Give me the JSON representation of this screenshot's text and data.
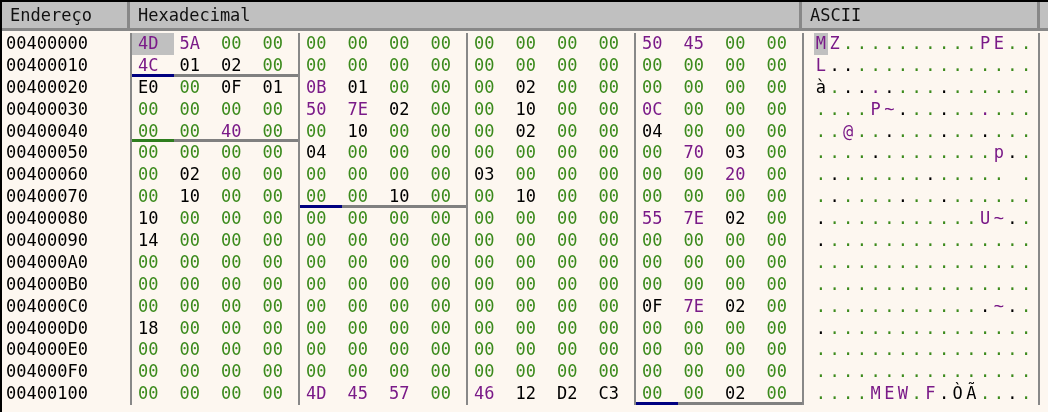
{
  "columns": [
    "Endereço",
    "Hexadecimal",
    "ASCII"
  ],
  "rows": [
    {
      "address": "00400000",
      "ascii": "MZ..........PE..",
      "bytes": [
        {
          "hex": "4D",
          "kind": "text",
          "selected": true
        },
        {
          "hex": "5A",
          "kind": "text",
          "selected": false
        },
        {
          "hex": "00",
          "kind": "zero",
          "selected": false
        },
        {
          "hex": "00",
          "kind": "zero",
          "selected": false
        },
        {
          "hex": "00",
          "kind": "zero",
          "selected": false
        },
        {
          "hex": "00",
          "kind": "zero",
          "selected": false
        },
        {
          "hex": "00",
          "kind": "zero",
          "selected": false
        },
        {
          "hex": "00",
          "kind": "zero",
          "selected": false
        },
        {
          "hex": "00",
          "kind": "zero",
          "selected": false
        },
        {
          "hex": "00",
          "kind": "zero",
          "selected": false
        },
        {
          "hex": "00",
          "kind": "zero",
          "selected": false
        },
        {
          "hex": "00",
          "kind": "zero",
          "selected": false
        },
        {
          "hex": "50",
          "kind": "text",
          "selected": false
        },
        {
          "hex": "45",
          "kind": "text",
          "selected": false
        },
        {
          "hex": "00",
          "kind": "zero",
          "selected": false
        },
        {
          "hex": "00",
          "kind": "zero",
          "selected": false
        }
      ]
    },
    {
      "address": "00400010",
      "ascii": "L...............",
      "bytes": [
        {
          "hex": "4C",
          "kind": "text",
          "selected": false,
          "color": "#000080"
        },
        {
          "hex": "01",
          "kind": "other",
          "selected": false,
          "color": "#808080"
        },
        {
          "hex": "02",
          "kind": "other",
          "selected": false,
          "color": "#808080"
        },
        {
          "hex": "00",
          "kind": "zero",
          "selected": false,
          "color": "#808080"
        },
        {
          "hex": "00",
          "kind": "zero",
          "selected": false
        },
        {
          "hex": "00",
          "kind": "zero",
          "selected": false
        },
        {
          "hex": "00",
          "kind": "zero",
          "selected": false
        },
        {
          "hex": "00",
          "kind": "zero",
          "selected": false
        },
        {
          "hex": "00",
          "kind": "zero",
          "selected": false
        },
        {
          "hex": "00",
          "kind": "zero",
          "selected": false
        },
        {
          "hex": "00",
          "kind": "zero",
          "selected": false
        },
        {
          "hex": "00",
          "kind": "zero",
          "selected": false
        },
        {
          "hex": "00",
          "kind": "zero",
          "selected": false
        },
        {
          "hex": "00",
          "kind": "zero",
          "selected": false
        },
        {
          "hex": "00",
          "kind": "zero",
          "selected": false
        },
        {
          "hex": "00",
          "kind": "zero",
          "selected": false
        }
      ]
    },
    {
      "address": "00400020",
      "ascii": "à...............",
      "bytes": [
        {
          "hex": "E0",
          "kind": "other",
          "selected": false
        },
        {
          "hex": "00",
          "kind": "zero",
          "selected": false
        },
        {
          "hex": "0F",
          "kind": "other",
          "selected": false
        },
        {
          "hex": "01",
          "kind": "other",
          "selected": false
        },
        {
          "hex": "0B",
          "kind": "text",
          "selected": false
        },
        {
          "hex": "01",
          "kind": "other",
          "selected": false
        },
        {
          "hex": "00",
          "kind": "zero",
          "selected": false
        },
        {
          "hex": "00",
          "kind": "zero",
          "selected": false
        },
        {
          "hex": "00",
          "kind": "zero",
          "selected": false
        },
        {
          "hex": "02",
          "kind": "other",
          "selected": false
        },
        {
          "hex": "00",
          "kind": "zero",
          "selected": false
        },
        {
          "hex": "00",
          "kind": "zero",
          "selected": false
        },
        {
          "hex": "00",
          "kind": "zero",
          "selected": false
        },
        {
          "hex": "00",
          "kind": "zero",
          "selected": false
        },
        {
          "hex": "00",
          "kind": "zero",
          "selected": false
        },
        {
          "hex": "00",
          "kind": "zero",
          "selected": false
        }
      ]
    },
    {
      "address": "00400030",
      "ascii": "....P~..........",
      "bytes": [
        {
          "hex": "00",
          "kind": "zero",
          "selected": false
        },
        {
          "hex": "00",
          "kind": "zero",
          "selected": false
        },
        {
          "hex": "00",
          "kind": "zero",
          "selected": false
        },
        {
          "hex": "00",
          "kind": "zero",
          "selected": false
        },
        {
          "hex": "50",
          "kind": "text",
          "selected": false
        },
        {
          "hex": "7E",
          "kind": "text",
          "selected": false
        },
        {
          "hex": "02",
          "kind": "other",
          "selected": false
        },
        {
          "hex": "00",
          "kind": "zero",
          "selected": false
        },
        {
          "hex": "00",
          "kind": "zero",
          "selected": false
        },
        {
          "hex": "10",
          "kind": "other",
          "selected": false
        },
        {
          "hex": "00",
          "kind": "zero",
          "selected": false
        },
        {
          "hex": "00",
          "kind": "zero",
          "selected": false
        },
        {
          "hex": "0C",
          "kind": "text",
          "selected": false
        },
        {
          "hex": "00",
          "kind": "zero",
          "selected": false
        },
        {
          "hex": "00",
          "kind": "zero",
          "selected": false
        },
        {
          "hex": "00",
          "kind": "zero",
          "selected": false
        }
      ]
    },
    {
      "address": "00400040",
      "ascii": "..@.............",
      "bytes": [
        {
          "hex": "00",
          "kind": "zero",
          "selected": false,
          "color": "#2e7d1e"
        },
        {
          "hex": "00",
          "kind": "zero",
          "selected": false,
          "color": "#808080"
        },
        {
          "hex": "40",
          "kind": "text",
          "selected": false,
          "color": "#808080"
        },
        {
          "hex": "00",
          "kind": "zero",
          "selected": false,
          "color": "#808080"
        },
        {
          "hex": "00",
          "kind": "zero",
          "selected": false
        },
        {
          "hex": "10",
          "kind": "other",
          "selected": false
        },
        {
          "hex": "00",
          "kind": "zero",
          "selected": false
        },
        {
          "hex": "00",
          "kind": "zero",
          "selected": false
        },
        {
          "hex": "00",
          "kind": "zero",
          "selected": false
        },
        {
          "hex": "02",
          "kind": "other",
          "selected": false
        },
        {
          "hex": "00",
          "kind": "zero",
          "selected": false
        },
        {
          "hex": "00",
          "kind": "zero",
          "selected": false
        },
        {
          "hex": "04",
          "kind": "other",
          "selected": false
        },
        {
          "hex": "00",
          "kind": "zero",
          "selected": false
        },
        {
          "hex": "00",
          "kind": "zero",
          "selected": false
        },
        {
          "hex": "00",
          "kind": "zero",
          "selected": false
        }
      ]
    },
    {
      "address": "00400050",
      "ascii": ".............p..",
      "bytes": [
        {
          "hex": "00",
          "kind": "zero",
          "selected": false
        },
        {
          "hex": "00",
          "kind": "zero",
          "selected": false
        },
        {
          "hex": "00",
          "kind": "zero",
          "selected": false
        },
        {
          "hex": "00",
          "kind": "zero",
          "selected": false
        },
        {
          "hex": "04",
          "kind": "other",
          "selected": false
        },
        {
          "hex": "00",
          "kind": "zero",
          "selected": false
        },
        {
          "hex": "00",
          "kind": "zero",
          "selected": false
        },
        {
          "hex": "00",
          "kind": "zero",
          "selected": false
        },
        {
          "hex": "00",
          "kind": "zero",
          "selected": false
        },
        {
          "hex": "00",
          "kind": "zero",
          "selected": false
        },
        {
          "hex": "00",
          "kind": "zero",
          "selected": false
        },
        {
          "hex": "00",
          "kind": "zero",
          "selected": false
        },
        {
          "hex": "00",
          "kind": "zero",
          "selected": false
        },
        {
          "hex": "70",
          "kind": "text",
          "selected": false
        },
        {
          "hex": "03",
          "kind": "other",
          "selected": false
        },
        {
          "hex": "00",
          "kind": "zero",
          "selected": false
        }
      ]
    },
    {
      "address": "00400060",
      "ascii": ".............. .",
      "bytes": [
        {
          "hex": "00",
          "kind": "zero",
          "selected": false
        },
        {
          "hex": "02",
          "kind": "other",
          "selected": false
        },
        {
          "hex": "00",
          "kind": "zero",
          "selected": false
        },
        {
          "hex": "00",
          "kind": "zero",
          "selected": false
        },
        {
          "hex": "00",
          "kind": "zero",
          "selected": false
        },
        {
          "hex": "00",
          "kind": "zero",
          "selected": false
        },
        {
          "hex": "00",
          "kind": "zero",
          "selected": false
        },
        {
          "hex": "00",
          "kind": "zero",
          "selected": false
        },
        {
          "hex": "03",
          "kind": "other",
          "selected": false
        },
        {
          "hex": "00",
          "kind": "zero",
          "selected": false
        },
        {
          "hex": "00",
          "kind": "zero",
          "selected": false
        },
        {
          "hex": "00",
          "kind": "zero",
          "selected": false
        },
        {
          "hex": "00",
          "kind": "zero",
          "selected": false
        },
        {
          "hex": "00",
          "kind": "zero",
          "selected": false
        },
        {
          "hex": "20",
          "kind": "text",
          "selected": false
        },
        {
          "hex": "00",
          "kind": "zero",
          "selected": false
        }
      ]
    },
    {
      "address": "00400070",
      "ascii": "................",
      "bytes": [
        {
          "hex": "00",
          "kind": "zero",
          "selected": false
        },
        {
          "hex": "10",
          "kind": "other",
          "selected": false
        },
        {
          "hex": "00",
          "kind": "zero",
          "selected": false
        },
        {
          "hex": "00",
          "kind": "zero",
          "selected": false
        },
        {
          "hex": "00",
          "kind": "zero",
          "selected": false,
          "color": "#000080"
        },
        {
          "hex": "00",
          "kind": "zero",
          "selected": false,
          "color": "#808080"
        },
        {
          "hex": "10",
          "kind": "other",
          "selected": false,
          "color": "#808080"
        },
        {
          "hex": "00",
          "kind": "zero",
          "selected": false,
          "color": "#808080"
        },
        {
          "hex": "00",
          "kind": "zero",
          "selected": false
        },
        {
          "hex": "10",
          "kind": "other",
          "selected": false
        },
        {
          "hex": "00",
          "kind": "zero",
          "selected": false
        },
        {
          "hex": "00",
          "kind": "zero",
          "selected": false
        },
        {
          "hex": "00",
          "kind": "zero",
          "selected": false
        },
        {
          "hex": "00",
          "kind": "zero",
          "selected": false
        },
        {
          "hex": "00",
          "kind": "zero",
          "selected": false
        },
        {
          "hex": "00",
          "kind": "zero",
          "selected": false
        }
      ]
    },
    {
      "address": "00400080",
      "ascii": "............U~..",
      "bytes": [
        {
          "hex": "10",
          "kind": "other",
          "selected": false
        },
        {
          "hex": "00",
          "kind": "zero",
          "selected": false
        },
        {
          "hex": "00",
          "kind": "zero",
          "selected": false
        },
        {
          "hex": "00",
          "kind": "zero",
          "selected": false
        },
        {
          "hex": "00",
          "kind": "zero",
          "selected": false
        },
        {
          "hex": "00",
          "kind": "zero",
          "selected": false
        },
        {
          "hex": "00",
          "kind": "zero",
          "selected": false
        },
        {
          "hex": "00",
          "kind": "zero",
          "selected": false
        },
        {
          "hex": "00",
          "kind": "zero",
          "selected": false
        },
        {
          "hex": "00",
          "kind": "zero",
          "selected": false
        },
        {
          "hex": "00",
          "kind": "zero",
          "selected": false
        },
        {
          "hex": "00",
          "kind": "zero",
          "selected": false
        },
        {
          "hex": "55",
          "kind": "text",
          "selected": false
        },
        {
          "hex": "7E",
          "kind": "text",
          "selected": false
        },
        {
          "hex": "02",
          "kind": "other",
          "selected": false
        },
        {
          "hex": "00",
          "kind": "zero",
          "selected": false
        }
      ]
    },
    {
      "address": "00400090",
      "ascii": "................",
      "bytes": [
        {
          "hex": "14",
          "kind": "other",
          "selected": false
        },
        {
          "hex": "00",
          "kind": "zero",
          "selected": false
        },
        {
          "hex": "00",
          "kind": "zero",
          "selected": false
        },
        {
          "hex": "00",
          "kind": "zero",
          "selected": false
        },
        {
          "hex": "00",
          "kind": "zero",
          "selected": false
        },
        {
          "hex": "00",
          "kind": "zero",
          "selected": false
        },
        {
          "hex": "00",
          "kind": "zero",
          "selected": false
        },
        {
          "hex": "00",
          "kind": "zero",
          "selected": false
        },
        {
          "hex": "00",
          "kind": "zero",
          "selected": false
        },
        {
          "hex": "00",
          "kind": "zero",
          "selected": false
        },
        {
          "hex": "00",
          "kind": "zero",
          "selected": false
        },
        {
          "hex": "00",
          "kind": "zero",
          "selected": false
        },
        {
          "hex": "00",
          "kind": "zero",
          "selected": false
        },
        {
          "hex": "00",
          "kind": "zero",
          "selected": false
        },
        {
          "hex": "00",
          "kind": "zero",
          "selected": false
        },
        {
          "hex": "00",
          "kind": "zero",
          "selected": false
        }
      ]
    },
    {
      "address": "004000A0",
      "ascii": "................",
      "bytes": [
        {
          "hex": "00",
          "kind": "zero",
          "selected": false
        },
        {
          "hex": "00",
          "kind": "zero",
          "selected": false
        },
        {
          "hex": "00",
          "kind": "zero",
          "selected": false
        },
        {
          "hex": "00",
          "kind": "zero",
          "selected": false
        },
        {
          "hex": "00",
          "kind": "zero",
          "selected": false
        },
        {
          "hex": "00",
          "kind": "zero",
          "selected": false
        },
        {
          "hex": "00",
          "kind": "zero",
          "selected": false
        },
        {
          "hex": "00",
          "kind": "zero",
          "selected": false
        },
        {
          "hex": "00",
          "kind": "zero",
          "selected": false
        },
        {
          "hex": "00",
          "kind": "zero",
          "selected": false
        },
        {
          "hex": "00",
          "kind": "zero",
          "selected": false
        },
        {
          "hex": "00",
          "kind": "zero",
          "selected": false
        },
        {
          "hex": "00",
          "kind": "zero",
          "selected": false
        },
        {
          "hex": "00",
          "kind": "zero",
          "selected": false
        },
        {
          "hex": "00",
          "kind": "zero",
          "selected": false
        },
        {
          "hex": "00",
          "kind": "zero",
          "selected": false
        }
      ]
    },
    {
      "address": "004000B0",
      "ascii": "................",
      "bytes": [
        {
          "hex": "00",
          "kind": "zero",
          "selected": false
        },
        {
          "hex": "00",
          "kind": "zero",
          "selected": false
        },
        {
          "hex": "00",
          "kind": "zero",
          "selected": false
        },
        {
          "hex": "00",
          "kind": "zero",
          "selected": false
        },
        {
          "hex": "00",
          "kind": "zero",
          "selected": false
        },
        {
          "hex": "00",
          "kind": "zero",
          "selected": false
        },
        {
          "hex": "00",
          "kind": "zero",
          "selected": false
        },
        {
          "hex": "00",
          "kind": "zero",
          "selected": false
        },
        {
          "hex": "00",
          "kind": "zero",
          "selected": false
        },
        {
          "hex": "00",
          "kind": "zero",
          "selected": false
        },
        {
          "hex": "00",
          "kind": "zero",
          "selected": false
        },
        {
          "hex": "00",
          "kind": "zero",
          "selected": false
        },
        {
          "hex": "00",
          "kind": "zero",
          "selected": false
        },
        {
          "hex": "00",
          "kind": "zero",
          "selected": false
        },
        {
          "hex": "00",
          "kind": "zero",
          "selected": false
        },
        {
          "hex": "00",
          "kind": "zero",
          "selected": false
        }
      ]
    },
    {
      "address": "004000C0",
      "ascii": ".............~..",
      "bytes": [
        {
          "hex": "00",
          "kind": "zero",
          "selected": false
        },
        {
          "hex": "00",
          "kind": "zero",
          "selected": false
        },
        {
          "hex": "00",
          "kind": "zero",
          "selected": false
        },
        {
          "hex": "00",
          "kind": "zero",
          "selected": false
        },
        {
          "hex": "00",
          "kind": "zero",
          "selected": false
        },
        {
          "hex": "00",
          "kind": "zero",
          "selected": false
        },
        {
          "hex": "00",
          "kind": "zero",
          "selected": false
        },
        {
          "hex": "00",
          "kind": "zero",
          "selected": false
        },
        {
          "hex": "00",
          "kind": "zero",
          "selected": false
        },
        {
          "hex": "00",
          "kind": "zero",
          "selected": false
        },
        {
          "hex": "00",
          "kind": "zero",
          "selected": false
        },
        {
          "hex": "00",
          "kind": "zero",
          "selected": false
        },
        {
          "hex": "0F",
          "kind": "other",
          "selected": false
        },
        {
          "hex": "7E",
          "kind": "text",
          "selected": false
        },
        {
          "hex": "02",
          "kind": "other",
          "selected": false
        },
        {
          "hex": "00",
          "kind": "zero",
          "selected": false
        }
      ]
    },
    {
      "address": "004000D0",
      "ascii": "................",
      "bytes": [
        {
          "hex": "18",
          "kind": "other",
          "selected": false
        },
        {
          "hex": "00",
          "kind": "zero",
          "selected": false
        },
        {
          "hex": "00",
          "kind": "zero",
          "selected": false
        },
        {
          "hex": "00",
          "kind": "zero",
          "selected": false
        },
        {
          "hex": "00",
          "kind": "zero",
          "selected": false
        },
        {
          "hex": "00",
          "kind": "zero",
          "selected": false
        },
        {
          "hex": "00",
          "kind": "zero",
          "selected": false
        },
        {
          "hex": "00",
          "kind": "zero",
          "selected": false
        },
        {
          "hex": "00",
          "kind": "zero",
          "selected": false
        },
        {
          "hex": "00",
          "kind": "zero",
          "selected": false
        },
        {
          "hex": "00",
          "kind": "zero",
          "selected": false
        },
        {
          "hex": "00",
          "kind": "zero",
          "selected": false
        },
        {
          "hex": "00",
          "kind": "zero",
          "selected": false
        },
        {
          "hex": "00",
          "kind": "zero",
          "selected": false
        },
        {
          "hex": "00",
          "kind": "zero",
          "selected": false
        },
        {
          "hex": "00",
          "kind": "zero",
          "selected": false
        }
      ]
    },
    {
      "address": "004000E0",
      "ascii": "................",
      "bytes": [
        {
          "hex": "00",
          "kind": "zero",
          "selected": false
        },
        {
          "hex": "00",
          "kind": "zero",
          "selected": false
        },
        {
          "hex": "00",
          "kind": "zero",
          "selected": false
        },
        {
          "hex": "00",
          "kind": "zero",
          "selected": false
        },
        {
          "hex": "00",
          "kind": "zero",
          "selected": false
        },
        {
          "hex": "00",
          "kind": "zero",
          "selected": false
        },
        {
          "hex": "00",
          "kind": "zero",
          "selected": false
        },
        {
          "hex": "00",
          "kind": "zero",
          "selected": false
        },
        {
          "hex": "00",
          "kind": "zero",
          "selected": false
        },
        {
          "hex": "00",
          "kind": "zero",
          "selected": false
        },
        {
          "hex": "00",
          "kind": "zero",
          "selected": false
        },
        {
          "hex": "00",
          "kind": "zero",
          "selected": false
        },
        {
          "hex": "00",
          "kind": "zero",
          "selected": false
        },
        {
          "hex": "00",
          "kind": "zero",
          "selected": false
        },
        {
          "hex": "00",
          "kind": "zero",
          "selected": false
        },
        {
          "hex": "00",
          "kind": "zero",
          "selected": false
        }
      ]
    },
    {
      "address": "004000F0",
      "ascii": "................",
      "bytes": [
        {
          "hex": "00",
          "kind": "zero",
          "selected": false
        },
        {
          "hex": "00",
          "kind": "zero",
          "selected": false
        },
        {
          "hex": "00",
          "kind": "zero",
          "selected": false
        },
        {
          "hex": "00",
          "kind": "zero",
          "selected": false
        },
        {
          "hex": "00",
          "kind": "zero",
          "selected": false
        },
        {
          "hex": "00",
          "kind": "zero",
          "selected": false
        },
        {
          "hex": "00",
          "kind": "zero",
          "selected": false
        },
        {
          "hex": "00",
          "kind": "zero",
          "selected": false
        },
        {
          "hex": "00",
          "kind": "zero",
          "selected": false
        },
        {
          "hex": "00",
          "kind": "zero",
          "selected": false
        },
        {
          "hex": "00",
          "kind": "zero",
          "selected": false
        },
        {
          "hex": "00",
          "kind": "zero",
          "selected": false
        },
        {
          "hex": "00",
          "kind": "zero",
          "selected": false
        },
        {
          "hex": "00",
          "kind": "zero",
          "selected": false
        },
        {
          "hex": "00",
          "kind": "zero",
          "selected": false
        },
        {
          "hex": "00",
          "kind": "zero",
          "selected": false
        }
      ]
    },
    {
      "address": "00400100",
      "ascii": "....MEW.F.ÒÃ....",
      "bytes": [
        {
          "hex": "00",
          "kind": "zero",
          "selected": false
        },
        {
          "hex": "00",
          "kind": "zero",
          "selected": false
        },
        {
          "hex": "00",
          "kind": "zero",
          "selected": false
        },
        {
          "hex": "00",
          "kind": "zero",
          "selected": false
        },
        {
          "hex": "4D",
          "kind": "text",
          "selected": false
        },
        {
          "hex": "45",
          "kind": "text",
          "selected": false
        },
        {
          "hex": "57",
          "kind": "text",
          "selected": false
        },
        {
          "hex": "00",
          "kind": "zero",
          "selected": false
        },
        {
          "hex": "46",
          "kind": "text",
          "selected": false
        },
        {
          "hex": "12",
          "kind": "other",
          "selected": false
        },
        {
          "hex": "D2",
          "kind": "other",
          "selected": false
        },
        {
          "hex": "C3",
          "kind": "other",
          "selected": false
        },
        {
          "hex": "00",
          "kind": "zero",
          "selected": false,
          "color": "#000080"
        },
        {
          "hex": "00",
          "kind": "zero",
          "selected": false,
          "color": "#808080"
        },
        {
          "hex": "02",
          "kind": "other",
          "selected": false,
          "color": "#808080"
        },
        {
          "hex": "00",
          "kind": "zero",
          "selected": false,
          "color": "#808080"
        }
      ]
    }
  ]
}
